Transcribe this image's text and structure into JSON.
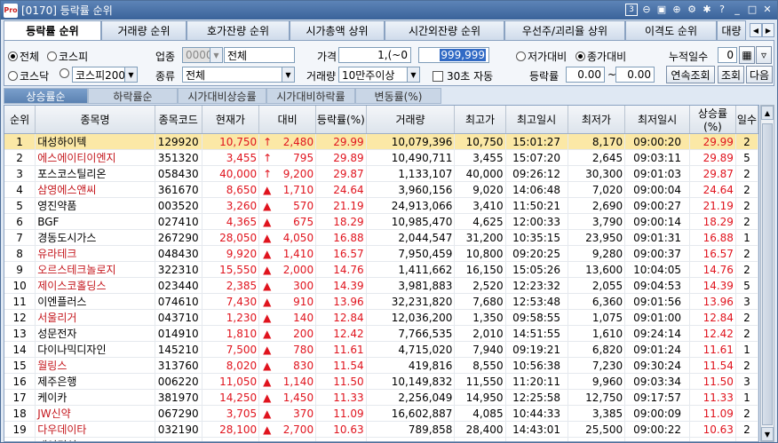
{
  "window": {
    "title": "[0170] 등락률 순위",
    "page_no": "3"
  },
  "tabs": [
    "등락률 순위",
    "거래량 순위",
    "호가잔량 순위",
    "시가총액 상위",
    "시간외잔량 순위",
    "우선주/괴리율 상위",
    "이격도 순위",
    "대량"
  ],
  "filters": {
    "market_all": "전체",
    "kospi": "코스피",
    "kosdaq": "코스닥",
    "kospi_select": "코스피200",
    "industry_label": "업종",
    "industry_code": "0000",
    "industry_name": "전체",
    "type_label": "종류",
    "type_value": "전체",
    "price_label": "가격",
    "price_from": "1,(~0",
    "price_to": "999,999",
    "volume_label": "거래량",
    "volume_value": "10만주이상",
    "auto_label": "30초 자동",
    "low_compare": "저가대비",
    "close_compare": "종가대비",
    "days_label": "누적일수",
    "days_value": "0",
    "rate_label": "등락률",
    "rate_from": "0.00",
    "rate_sep": "~",
    "rate_to": "0.00",
    "btn_continuous": "연속조회",
    "btn_query": "조회",
    "btn_next": "다음"
  },
  "subtabs": [
    "상승률순",
    "하락률순",
    "시가대비상승률",
    "시가대비하락률",
    "변동률(%)"
  ],
  "columns": [
    "순위",
    "종목명",
    "종목코드",
    "현재가",
    "대비",
    "등락률(%)",
    "거래량",
    "최고가",
    "최고일시",
    "최저가",
    "최저일시",
    "상승률(%)",
    "일수"
  ],
  "rows": [
    {
      "rank": "1",
      "name": "대성하이텍",
      "code": "129920",
      "price": "10,750",
      "sign": "↑",
      "change": "2,480",
      "rate": "29.99",
      "volume": "10,079,396",
      "high": "10,750",
      "high_time": "15:01:27",
      "low": "8,170",
      "low_time": "09:00:20",
      "up_rate": "29.99",
      "days": "2"
    },
    {
      "rank": "2",
      "name": "에스에이티이엔지",
      "code": "351320",
      "price": "3,455",
      "sign": "↑",
      "change": "795",
      "rate": "29.89",
      "volume": "10,490,711",
      "high": "3,455",
      "high_time": "15:07:20",
      "low": "2,645",
      "low_time": "09:03:11",
      "up_rate": "29.89",
      "days": "5"
    },
    {
      "rank": "3",
      "name": "포스코스틸리온",
      "code": "058430",
      "price": "40,000",
      "sign": "↑",
      "change": "9,200",
      "rate": "29.87",
      "volume": "1,133,107",
      "high": "40,000",
      "high_time": "09:26:12",
      "low": "30,300",
      "low_time": "09:01:03",
      "up_rate": "29.87",
      "days": "2"
    },
    {
      "rank": "4",
      "name": "삼영에스앤씨",
      "code": "361670",
      "price": "8,650",
      "sign": "▲",
      "change": "1,710",
      "rate": "24.64",
      "volume": "3,960,156",
      "high": "9,020",
      "high_time": "14:06:48",
      "low": "7,020",
      "low_time": "09:00:04",
      "up_rate": "24.64",
      "days": "2"
    },
    {
      "rank": "5",
      "name": "영진약품",
      "code": "003520",
      "price": "3,260",
      "sign": "▲",
      "change": "570",
      "rate": "21.19",
      "volume": "24,913,066",
      "high": "3,410",
      "high_time": "11:50:21",
      "low": "2,690",
      "low_time": "09:00:27",
      "up_rate": "21.19",
      "days": "2"
    },
    {
      "rank": "6",
      "name": "BGF",
      "code": "027410",
      "price": "4,365",
      "sign": "▲",
      "change": "675",
      "rate": "18.29",
      "volume": "10,985,470",
      "high": "4,625",
      "high_time": "12:00:33",
      "low": "3,790",
      "low_time": "09:00:14",
      "up_rate": "18.29",
      "days": "2"
    },
    {
      "rank": "7",
      "name": "경동도시가스",
      "code": "267290",
      "price": "28,050",
      "sign": "▲",
      "change": "4,050",
      "rate": "16.88",
      "volume": "2,044,547",
      "high": "31,200",
      "high_time": "10:35:15",
      "low": "23,950",
      "low_time": "09:01:31",
      "up_rate": "16.88",
      "days": "1"
    },
    {
      "rank": "8",
      "name": "유라테크",
      "code": "048430",
      "price": "9,920",
      "sign": "▲",
      "change": "1,410",
      "rate": "16.57",
      "volume": "7,950,459",
      "high": "10,800",
      "high_time": "09:20:25",
      "low": "9,280",
      "low_time": "09:00:37",
      "up_rate": "16.57",
      "days": "2"
    },
    {
      "rank": "9",
      "name": "오르스테크놀로지",
      "code": "322310",
      "price": "15,550",
      "sign": "▲",
      "change": "2,000",
      "rate": "14.76",
      "volume": "1,411,662",
      "high": "16,150",
      "high_time": "15:05:26",
      "low": "13,600",
      "low_time": "10:04:05",
      "up_rate": "14.76",
      "days": "2"
    },
    {
      "rank": "10",
      "name": "제이스코홀딩스",
      "code": "023440",
      "price": "2,385",
      "sign": "▲",
      "change": "300",
      "rate": "14.39",
      "volume": "3,981,883",
      "high": "2,520",
      "high_time": "12:23:32",
      "low": "2,055",
      "low_time": "09:04:53",
      "up_rate": "14.39",
      "days": "5"
    },
    {
      "rank": "11",
      "name": "이엔플러스",
      "code": "074610",
      "price": "7,430",
      "sign": "▲",
      "change": "910",
      "rate": "13.96",
      "volume": "32,231,820",
      "high": "7,680",
      "high_time": "12:53:48",
      "low": "6,360",
      "low_time": "09:01:56",
      "up_rate": "13.96",
      "days": "3"
    },
    {
      "rank": "12",
      "name": "서울리거",
      "code": "043710",
      "price": "1,230",
      "sign": "▲",
      "change": "140",
      "rate": "12.84",
      "volume": "12,036,200",
      "high": "1,350",
      "high_time": "09:58:55",
      "low": "1,075",
      "low_time": "09:01:00",
      "up_rate": "12.84",
      "days": "2"
    },
    {
      "rank": "13",
      "name": "성문전자",
      "code": "014910",
      "price": "1,810",
      "sign": "▲",
      "change": "200",
      "rate": "12.42",
      "volume": "7,766,535",
      "high": "2,010",
      "high_time": "14:51:55",
      "low": "1,610",
      "low_time": "09:24:14",
      "up_rate": "12.42",
      "days": "2"
    },
    {
      "rank": "14",
      "name": "다이나믹디자인",
      "code": "145210",
      "price": "7,500",
      "sign": "▲",
      "change": "780",
      "rate": "11.61",
      "volume": "4,715,020",
      "high": "7,940",
      "high_time": "09:19:21",
      "low": "6,820",
      "low_time": "09:01:24",
      "up_rate": "11.61",
      "days": "1"
    },
    {
      "rank": "15",
      "name": "월링스",
      "code": "313760",
      "price": "8,020",
      "sign": "▲",
      "change": "830",
      "rate": "11.54",
      "volume": "419,816",
      "high": "8,550",
      "high_time": "10:56:38",
      "low": "7,230",
      "low_time": "09:30:24",
      "up_rate": "11.54",
      "days": "2"
    },
    {
      "rank": "16",
      "name": "제주은행",
      "code": "006220",
      "price": "11,050",
      "sign": "▲",
      "change": "1,140",
      "rate": "11.50",
      "volume": "10,149,832",
      "high": "11,550",
      "high_time": "11:20:11",
      "low": "9,960",
      "low_time": "09:03:34",
      "up_rate": "11.50",
      "days": "3"
    },
    {
      "rank": "17",
      "name": "케이카",
      "code": "381970",
      "price": "14,250",
      "sign": "▲",
      "change": "1,450",
      "rate": "11.33",
      "volume": "2,256,049",
      "high": "14,950",
      "high_time": "12:25:58",
      "low": "12,750",
      "low_time": "09:17:57",
      "up_rate": "11.33",
      "days": "1"
    },
    {
      "rank": "18",
      "name": "JW신약",
      "code": "067290",
      "price": "3,705",
      "sign": "▲",
      "change": "370",
      "rate": "11.09",
      "volume": "16,602,887",
      "high": "4,085",
      "high_time": "10:44:33",
      "low": "3,385",
      "low_time": "09:00:09",
      "up_rate": "11.09",
      "days": "2"
    },
    {
      "rank": "19",
      "name": "다우데이타",
      "code": "032190",
      "price": "28,100",
      "sign": "▲",
      "change": "2,700",
      "rate": "10.63",
      "volume": "789,858",
      "high": "28,400",
      "high_time": "14:43:01",
      "low": "25,500",
      "low_time": "09:00:22",
      "up_rate": "10.63",
      "days": "2"
    },
    {
      "rank": "20",
      "name": "태영건설",
      "code": "009410",
      "price": "4,965",
      "sign": "▲",
      "change": "460",
      "rate": "10.21",
      "volume": "1,751,046",
      "high": "5,200",
      "high_time": "13:42:38",
      "low": "4,510",
      "low_time": "09:00:05",
      "up_rate": "10.21",
      "days": "2"
    }
  ],
  "colors": {
    "up": "#e0141e",
    "selected_row": "#fbe8a6",
    "title_bar": "#3a639a"
  },
  "icons": [
    "app-logo-icon",
    "zoom-out-icon",
    "zoom-in-icon",
    "window-icon",
    "settings-icon",
    "star-icon",
    "help-icon",
    "minimize-icon",
    "maximize-icon",
    "close-icon"
  ]
}
